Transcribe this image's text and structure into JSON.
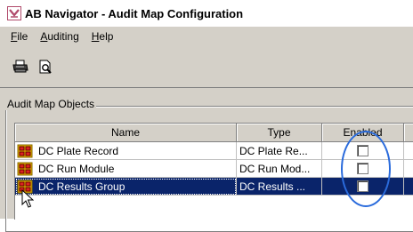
{
  "window": {
    "title": "AB Navigator - Audit Map Configuration"
  },
  "menu": {
    "items": [
      {
        "label": "File",
        "mnemonic": "F"
      },
      {
        "label": "Auditing",
        "mnemonic": "A"
      },
      {
        "label": "Help",
        "mnemonic": "H"
      }
    ]
  },
  "toolbar": {
    "buttons": [
      {
        "icon": "print-icon"
      },
      {
        "icon": "print-preview-icon"
      }
    ]
  },
  "group": {
    "title": "Audit Map Objects"
  },
  "table": {
    "columns": [
      "Name",
      "Type",
      "Enabled"
    ],
    "rows": [
      {
        "name": "DC Plate Record",
        "type": "DC Plate Re...",
        "enabled": false,
        "selected": false
      },
      {
        "name": "DC Run Module",
        "type": "DC Run Mod...",
        "enabled": false,
        "selected": false
      },
      {
        "name": "DC Results Group",
        "type": "DC Results ...",
        "enabled": false,
        "selected": true
      }
    ]
  },
  "colors": {
    "selection": "#0a246a",
    "highlight_annotation": "#2a6bdc",
    "window_face": "#d4d0c8"
  }
}
